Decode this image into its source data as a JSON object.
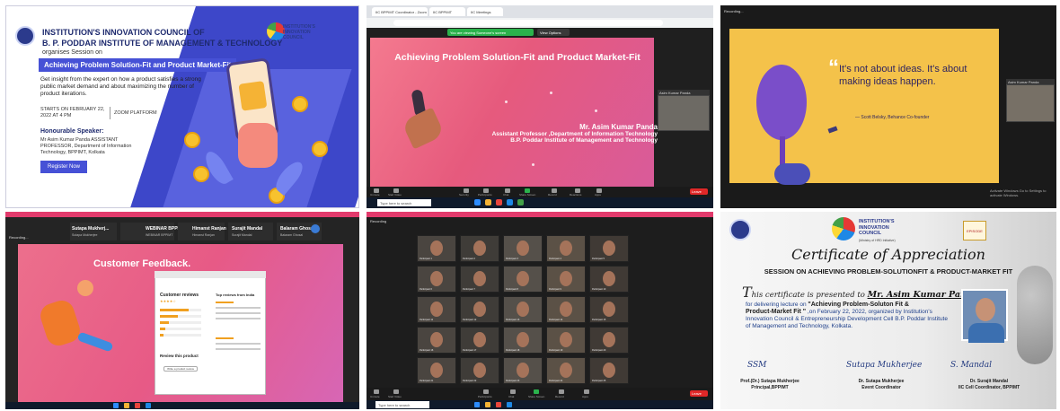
{
  "poster": {
    "org_line1": "INSTITUTION'S INNOVATION COUNCIL OF",
    "org_line2": "B. P. PODDAR INSTITUTE OF MANAGEMENT & TECHNOLOGY",
    "organises": "organises Session on",
    "session_title": "Achieving Problem Solution-Fit and Product Market-Fit",
    "description": "Get insight from the expert on how a product satisfies a strong public market demand and about maximizing the number of product iterations.",
    "starts": "STARTS ON FEBRUARY 22, 2022 AT 4 PM",
    "platform": "ZOOM PLATFORM",
    "speaker_heading": "Honourable Speaker:",
    "speaker_details": "Mr Asim Kumar Panda ASSISTANT PROFESSOR, Department of Information Technology, BPPIMT, Kolkata",
    "register_label": "Register Now",
    "iic_text": "INSTITUTION'S INNOVATION COUNCIL"
  },
  "zoom_slide": {
    "share_text": "You are viewing Someone's screen",
    "view_options": "View Options",
    "slide_title": "Achieving Problem Solution-Fit and Product Market-Fit",
    "presenter_name": "Mr. Asim Kumar Panda",
    "presenter_role": "Assistant Professor ,Department of Information Technology",
    "presenter_inst": "B.P. Poddar Institute of Management and Technology",
    "video_label": "Asim Kumar Panda",
    "tabs": [
      "IIC BPPIMT Coordinator - Zoom",
      "IIC BPPIMT",
      "IIC Meetings"
    ],
    "toolbar": [
      "Unmute",
      "Start Video",
      "Security",
      "Participants",
      "Chat",
      "Share Screen",
      "Record",
      "Reactions",
      "Apps"
    ],
    "leave_label": "Leave",
    "taskbar_search": "Type here to search"
  },
  "quote_slide": {
    "recording": "Recording...",
    "quote": "It's not about ideas. It's about making ideas happen.",
    "author": "— Scott Belsky, Behance Co-founder",
    "video_label": "Asim Kumar Panda",
    "activate": "Activate Windows Go to Settings to activate Windows."
  },
  "feedback_slide": {
    "recording": "Recording...",
    "participants": [
      {
        "name": "Sutapa Mukherj...",
        "sub": "Sutapa Mukherjee"
      },
      {
        "name": "WEBINAR BPPI...",
        "sub": "WEBINAR BPPIMT"
      },
      {
        "name": "Himanst Ranjan",
        "sub": "Himanst Ranjan"
      },
      {
        "name": "Surajit Mandal",
        "sub": "Surajit Mandal"
      },
      {
        "name": "Balaram Ghosal",
        "sub": "Balaram Ghosal"
      }
    ],
    "slide_title": "Customer Feedback.",
    "reviews_heading": "Customer reviews",
    "stars": "★★★★☆",
    "review_this": "Review this product",
    "write_button": "Write a product review",
    "top_reviews": "Top reviews from India"
  },
  "gallery": {
    "recording": "Recording",
    "participants": [
      "Participant 1",
      "Participant 2",
      "Participant 3",
      "Participant 4",
      "Participant 5",
      "Participant 6",
      "Participant 7",
      "Participant 8",
      "Participant 9",
      "Participant 10",
      "Participant 11",
      "Participant 12",
      "Participant 13",
      "Participant 14",
      "Participant 15",
      "Participant 16",
      "Participant 17",
      "Participant 18",
      "Participant 19",
      "Participant 20",
      "Participant 21",
      "Participant 22",
      "Participant 23",
      "Participant 24",
      "Participant 25"
    ],
    "toolbar": [
      "Unmute",
      "Start Video",
      "Participants",
      "Chat",
      "Share Screen",
      "Record",
      "Apps"
    ],
    "leave_label": "Leave",
    "taskbar_search": "Type here to search"
  },
  "certificate": {
    "iic_line1": "INSTITUTION'S",
    "iic_line2": "INNOVATION",
    "iic_line3": "COUNCIL",
    "iic_sub": "(Ministry of HRD Initiative)",
    "epi_label": "EPISODE",
    "title": "Certificate of Appreciation",
    "session": "SESSION ON ACHIEVING PROBLEM-SOLUTIONFIT & PRODUCT-MARKET FIT",
    "presented_prefix": "his certificate is presented to",
    "presented_t": "T",
    "recipient": "Mr. Asim Kumar Panda",
    "body_line1": "for delivering lecture on",
    "body_bold1": "\"Achieving Problem-Soluton Fit &",
    "body_bold2": "Product-Market Fit \"",
    "body_line2": ",on February 22, 2022, organized by Institution's Innovation Council & Entrepreneurship Development Cell B.P. Poddar Institute of Management and Technology, Kolkata.",
    "signatures": [
      {
        "sig": "SSM",
        "name": "Prof.(Dr.) Sutapa Mukherjee",
        "role": "Principal,BPPIMT"
      },
      {
        "sig": "Sutapa Mukherjee",
        "name": "Dr. Sutapa Mukherjee",
        "role": "Event Coordinator"
      },
      {
        "sig": "S. Mandal",
        "name": "Dr. Surajit Mandal",
        "role": "IIC Cell Coordinator, BPPIMT"
      }
    ]
  }
}
